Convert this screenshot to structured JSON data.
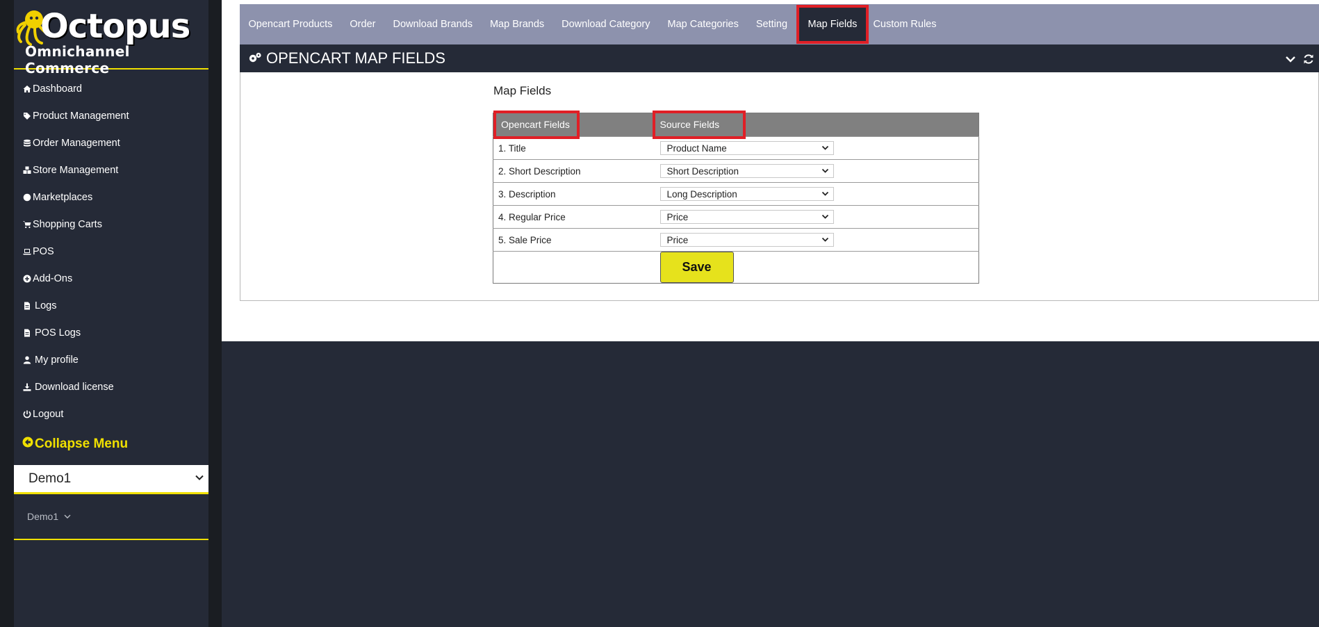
{
  "logo": {
    "title": "Octopus",
    "subtitle": "Omnichannel Commerce"
  },
  "sidebar": {
    "items": [
      {
        "label": "Dashboard",
        "icon": "home-icon"
      },
      {
        "label": "Product Management",
        "icon": "tag-icon"
      },
      {
        "label": "Order Management",
        "icon": "database-icon"
      },
      {
        "label": "Store Management",
        "icon": "cubes-icon"
      },
      {
        "label": "Marketplaces",
        "icon": "globe-icon"
      },
      {
        "label": "Shopping Carts",
        "icon": "cart-icon"
      },
      {
        "label": "POS",
        "icon": "laptop-icon"
      },
      {
        "label": "Add-Ons",
        "icon": "plus-circle-icon"
      },
      {
        "label": "Logs",
        "icon": "file-icon"
      },
      {
        "label": "POS Logs",
        "icon": "file-icon"
      },
      {
        "label": "My profile",
        "icon": "user-icon"
      },
      {
        "label": "Download license",
        "icon": "download-icon"
      },
      {
        "label": "Logout",
        "icon": "power-icon"
      }
    ],
    "collapse_label": "Collapse Menu",
    "store_select_value": "Demo1",
    "store_toggle_label": "Demo1"
  },
  "tabs": [
    {
      "label": "Opencart Products",
      "active": false
    },
    {
      "label": "Order",
      "active": false
    },
    {
      "label": "Download Brands",
      "active": false
    },
    {
      "label": "Map Brands",
      "active": false
    },
    {
      "label": "Download Category",
      "active": false
    },
    {
      "label": "Map Categories",
      "active": false
    },
    {
      "label": "Setting",
      "active": false
    },
    {
      "label": "Map Fields",
      "active": true
    },
    {
      "label": "Custom Rules",
      "active": false
    }
  ],
  "panel": {
    "title": "OPENCART MAP FIELDS"
  },
  "map": {
    "section_title": "Map Fields",
    "col_opencart": "Opencart Fields",
    "col_source": "Source Fields",
    "rows": [
      {
        "field": "1. Title",
        "source": "Product Name"
      },
      {
        "field": "2. Short Description",
        "source": "Short Description"
      },
      {
        "field": "3. Description",
        "source": "Long Description"
      },
      {
        "field": "4. Regular Price",
        "source": "Price"
      },
      {
        "field": "5. Sale Price",
        "source": "Price"
      }
    ],
    "save_label": "Save"
  },
  "colors": {
    "accent_yellow": "#f0e000",
    "highlight_red": "#e01f26",
    "dark": "#252a37",
    "tab_bar": "#8d92ad"
  }
}
